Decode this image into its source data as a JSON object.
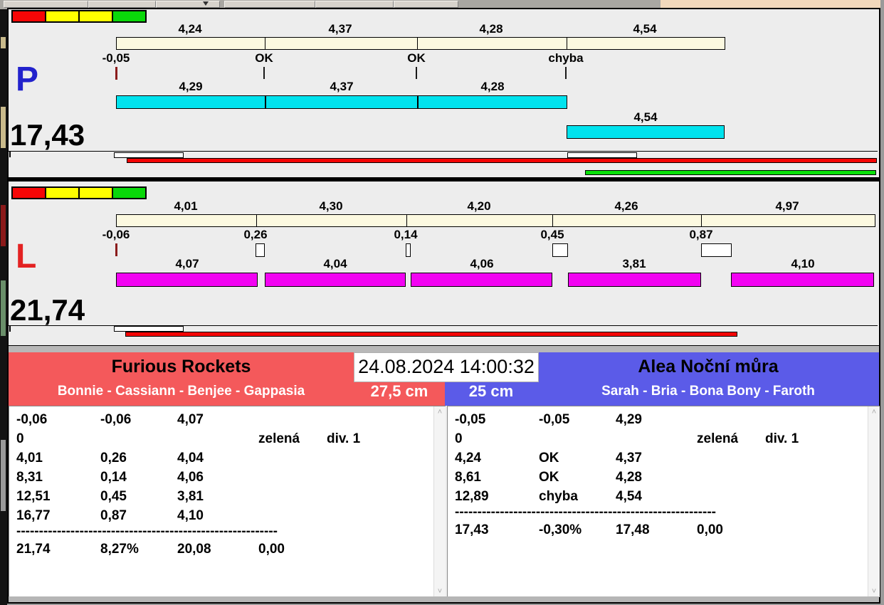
{
  "chrome": {
    "datetime": "24.08.2024 14:00:32"
  },
  "lanes": [
    {
      "id": "p",
      "letter": "P",
      "letter_color": "#2222cc",
      "total": "17,43",
      "lights": [
        "#f60606",
        "#ffff00",
        "#ffff00",
        "#0ad80a"
      ],
      "bar_color": "#00e3ee",
      "team_segments": [
        {
          "label": "4,24",
          "sec": 4.24
        },
        {
          "label": "4,37",
          "sec": 4.37
        },
        {
          "label": "4,28",
          "sec": 4.28
        },
        {
          "label": "4,54",
          "sec": 4.54
        }
      ],
      "markers": [
        {
          "label": "-0,05",
          "type": "start",
          "at": 0
        },
        {
          "label": "OK",
          "type": "ok",
          "at": 4.24
        },
        {
          "label": "OK",
          "type": "ok",
          "at": 8.61
        },
        {
          "label": "chyba",
          "type": "ok",
          "at": 12.89
        }
      ],
      "dog_bars": [
        {
          "label": "4,29",
          "start": 0,
          "sec": 4.29,
          "row": 0
        },
        {
          "label": "4,37",
          "start": 4.29,
          "sec": 4.37,
          "row": 0
        },
        {
          "label": "4,28",
          "start": 8.66,
          "sec": 4.28,
          "row": 0
        },
        {
          "label": "4,54",
          "start": 12.91,
          "sec": 4.54,
          "row": 1
        }
      ],
      "progress": [
        {
          "kind": "white",
          "start": -0.06,
          "sec": 2.0
        },
        {
          "kind": "white",
          "start": 12.94,
          "sec": 2.0
        },
        {
          "kind": "red",
          "start": 0.3,
          "sec": 21.5
        },
        {
          "kind": "green",
          "start": 13.45,
          "sec": 8.35
        }
      ]
    },
    {
      "id": "l",
      "letter": "L",
      "letter_color": "#e32222",
      "total": "21,74",
      "lights": [
        "#f60606",
        "#ffff00",
        "#ffff00",
        "#0ad80a"
      ],
      "bar_color": "#f203f2",
      "team_segments": [
        {
          "label": "4,01",
          "sec": 4.01
        },
        {
          "label": "4,30",
          "sec": 4.3
        },
        {
          "label": "4,20",
          "sec": 4.2
        },
        {
          "label": "4,26",
          "sec": 4.26
        },
        {
          "label": "4,97",
          "sec": 4.97
        }
      ],
      "markers": [
        {
          "label": "-0,06",
          "type": "start",
          "at": 0
        },
        {
          "label": "0,26",
          "type": "gap",
          "at": 4.01,
          "gap": 0.26
        },
        {
          "label": "0,14",
          "type": "gap",
          "at": 8.31,
          "gap": 0.14
        },
        {
          "label": "0,45",
          "type": "gap",
          "at": 12.51,
          "gap": 0.45
        },
        {
          "label": "0,87",
          "type": "gap",
          "at": 16.77,
          "gap": 0.87
        }
      ],
      "dog_bars": [
        {
          "label": "4,07",
          "start": 0,
          "sec": 4.07,
          "row": 0
        },
        {
          "label": "4,04",
          "start": 4.27,
          "sec": 4.04,
          "row": 0
        },
        {
          "label": "4,06",
          "start": 8.45,
          "sec": 4.06,
          "row": 0
        },
        {
          "label": "3,81",
          "start": 12.96,
          "sec": 3.81,
          "row": 0
        },
        {
          "label": "4,10",
          "start": 17.64,
          "sec": 4.1,
          "row": 0
        }
      ],
      "progress": [
        {
          "kind": "white",
          "start": -0.06,
          "sec": 2.0
        },
        {
          "kind": "red",
          "start": 0.27,
          "sec": 17.55
        }
      ]
    }
  ],
  "teams": [
    {
      "side": "left",
      "name": "Furious Rockets",
      "dogs": "Bonnie - Cassiann - Benjee - Gappasia",
      "height": "27,5 cm",
      "color": "#f4595b",
      "rows": [
        [
          "-0,06",
          "-0,06",
          "4,07",
          "",
          ""
        ],
        [
          "0",
          "",
          "",
          "zelená",
          "div. 1"
        ],
        [
          "4,01",
          "0,26",
          "4,04",
          "",
          ""
        ],
        [
          "8,31",
          "0,14",
          "4,06",
          "",
          ""
        ],
        [
          "12,51",
          "0,45",
          "3,81",
          "",
          ""
        ],
        [
          "16,77",
          "0,87",
          "4,10",
          "",
          ""
        ]
      ],
      "separator": "----------------------------------------------------------",
      "total_row": [
        "21,74",
        "8,27%",
        "20,08",
        "0,00"
      ]
    },
    {
      "side": "right",
      "name": "Alea Noční můra",
      "dogs": "Sarah - Bria - Bona Bony - Faroth",
      "height": "25 cm",
      "color": "#5b5be8",
      "rows": [
        [
          "-0,05",
          "-0,05",
          "4,29",
          "",
          ""
        ],
        [
          "0",
          "",
          "",
          "zelená",
          "div. 1"
        ],
        [
          "4,24",
          "OK",
          "4,37",
          "",
          ""
        ],
        [
          "8,61",
          "OK",
          "4,28",
          "",
          ""
        ],
        [
          "12,89",
          "chyba",
          "4,54",
          "",
          ""
        ]
      ],
      "separator": "----------------------------------------------------------",
      "total_row": [
        "17,43",
        "-0,30%",
        "17,48",
        "0,00"
      ]
    }
  ]
}
